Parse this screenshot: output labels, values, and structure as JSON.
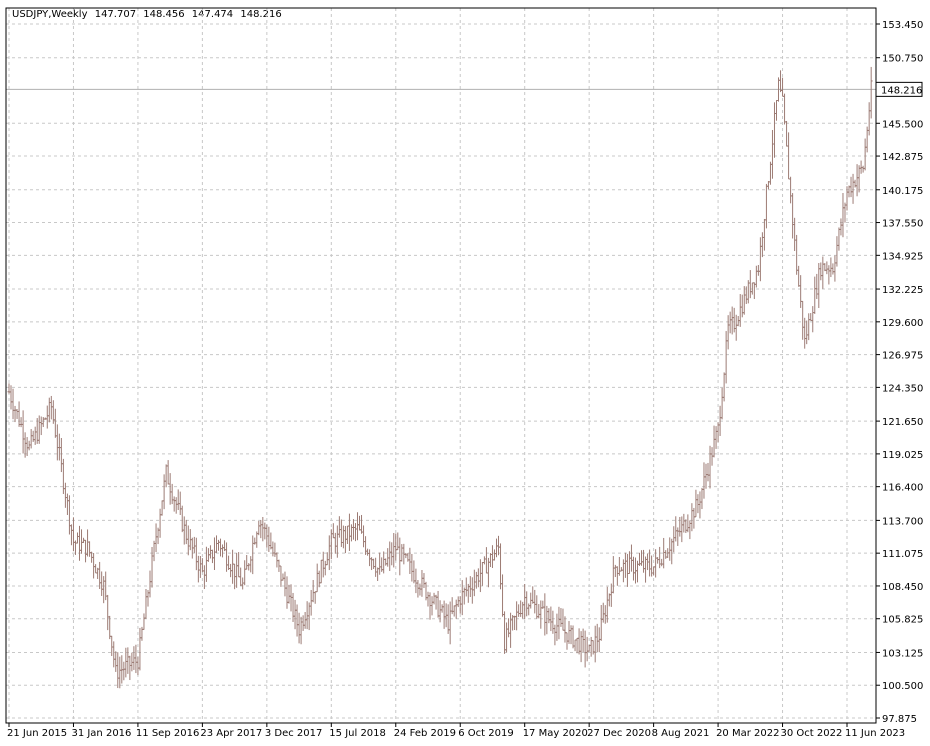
{
  "chart_data": {
    "type": "ohlc",
    "symbol": "USDJPY,Weekly",
    "last_ohlc": {
      "open": "147.707",
      "high": "148.456",
      "low": "147.474",
      "close": "148.216"
    },
    "current_price_label": "148.216",
    "current_price": 148.216,
    "ylim": [
      97.875,
      153.45
    ],
    "y_ticks": [
      "153.450",
      "150.750",
      "148.216",
      "145.500",
      "142.875",
      "140.175",
      "137.550",
      "134.925",
      "132.225",
      "129.600",
      "126.975",
      "124.350",
      "121.650",
      "119.025",
      "116.400",
      "113.700",
      "111.075",
      "108.450",
      "105.825",
      "103.125",
      "100.500",
      "97.875"
    ],
    "x_ticks": [
      "21 Jun 2015",
      "31 Jan 2016",
      "11 Sep 2016",
      "23 Apr 2017",
      "3 Dec 2017",
      "15 Jul 2018",
      "24 Feb 2019",
      "6 Oct 2019",
      "17 May 2020",
      "27 Dec 2020",
      "8 Aug 2021",
      "20 Mar 2022",
      "30 Oct 2022",
      "11 Jun 2023"
    ],
    "grid": true,
    "colors": {
      "bars": "#9c7b74",
      "grid": "#c8c8c8",
      "axis": "#000000",
      "price_line": "#b0b0b0"
    },
    "anchors": [
      [
        "21 Jun 2015",
        124.0
      ],
      [
        "30 Aug 2015",
        119.5
      ],
      [
        "15 Nov 2015",
        122.8
      ],
      [
        "31 Jan 2016",
        112.0
      ],
      [
        "20 Mar 2016",
        111.5
      ],
      [
        "15 May 2016",
        108.5
      ],
      [
        "26 Jun 2016",
        101.5
      ],
      [
        "31 Jul 2016",
        102.0
      ],
      [
        "11 Sep 2016",
        102.5
      ],
      [
        "13 Nov 2016",
        112.5
      ],
      [
        "18 Dec 2016",
        117.5
      ],
      [
        "26 Feb 2017",
        112.5
      ],
      [
        "23 Apr 2017",
        109.5
      ],
      [
        "18 Jun 2017",
        112.0
      ],
      [
        "10 Sep 2017",
        108.5
      ],
      [
        "5 Nov 2017",
        113.8
      ],
      [
        "3 Dec 2017",
        112.5
      ],
      [
        "25 Mar 2018",
        105.0
      ],
      [
        "15 Jul 2018",
        112.0
      ],
      [
        "14 Oct 2018",
        113.0
      ],
      [
        "30 Dec 2018",
        109.5
      ],
      [
        "24 Feb 2019",
        111.5
      ],
      [
        "26 May 2019",
        108.5
      ],
      [
        "25 Aug 2019",
        105.5
      ],
      [
        "6 Oct 2019",
        107.5
      ],
      [
        "15 Dec 2019",
        109.5
      ],
      [
        "16 Feb 2020",
        111.5
      ],
      [
        "8 Mar 2020",
        104.0
      ],
      [
        "17 May 2020",
        107.5
      ],
      [
        "9 Aug 2020",
        105.8
      ],
      [
        "27 Dec 2020",
        103.2
      ],
      [
        "31 Jan 2021",
        104.5
      ],
      [
        "28 Mar 2021",
        110.0
      ],
      [
        "8 Aug 2021",
        110.0
      ],
      [
        "28 Nov 2021",
        113.5
      ],
      [
        "9 Jan 2022",
        115.0
      ],
      [
        "20 Mar 2022",
        121.0
      ],
      [
        "24 Apr 2022",
        129.0
      ],
      [
        "15 May 2022",
        129.5
      ],
      [
        "7 Aug 2022",
        134.0
      ],
      [
        "16 Oct 2022",
        148.5
      ],
      [
        "30 Oct 2022",
        147.0
      ],
      [
        "18 Dec 2022",
        134.0
      ],
      [
        "15 Jan 2023",
        128.0
      ],
      [
        "12 Mar 2023",
        134.0
      ],
      [
        "23 Apr 2023",
        134.0
      ],
      [
        "11 Jun 2023",
        140.0
      ],
      [
        "6 Aug 2023",
        142.0
      ],
      [
        "3 Sep 2023",
        148.2
      ]
    ]
  }
}
